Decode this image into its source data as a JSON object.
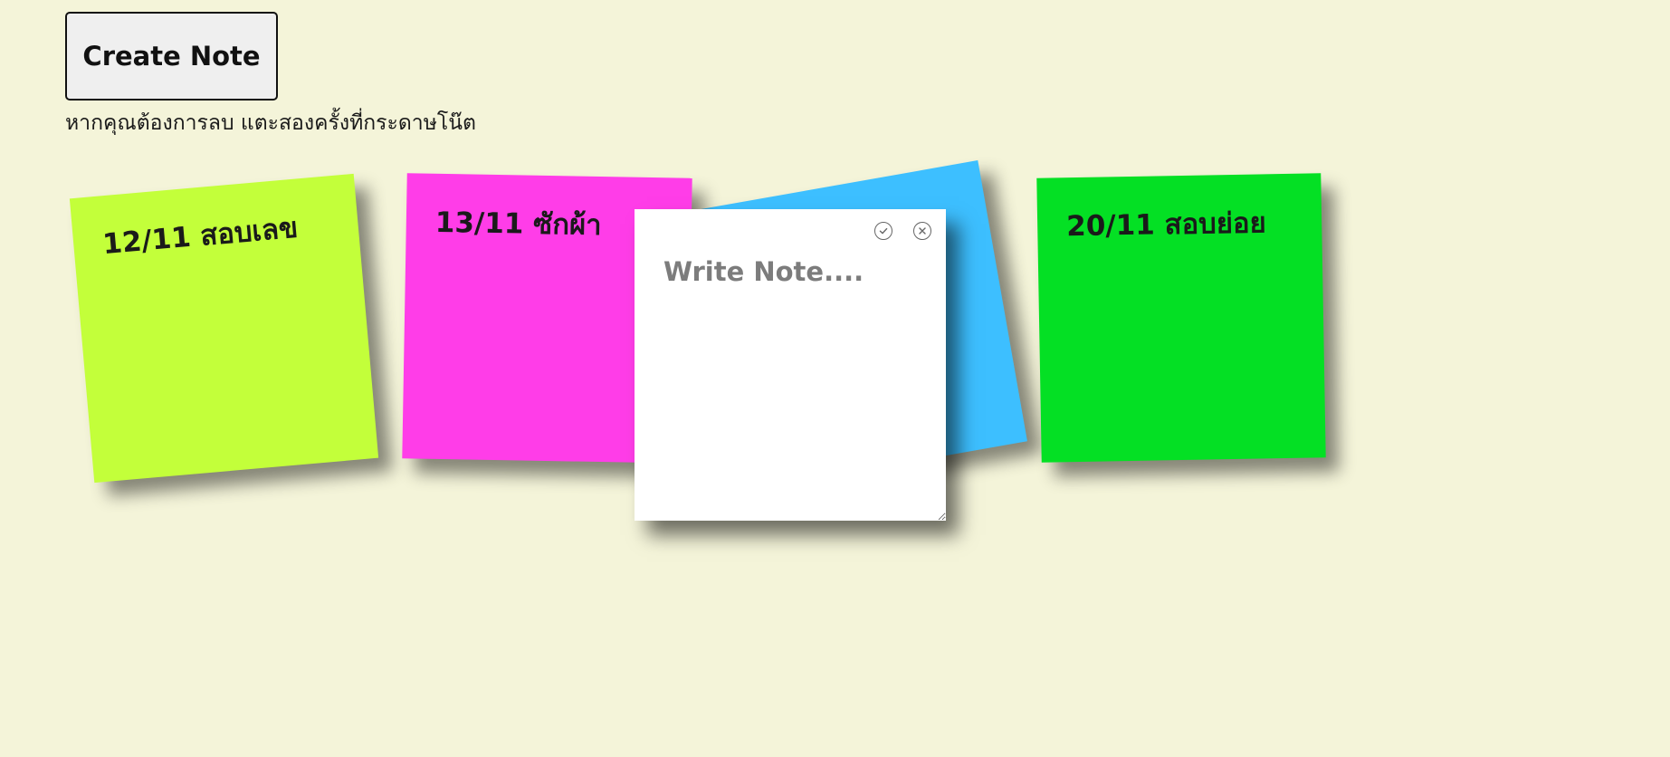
{
  "app": {
    "create_button_label": "Create Note",
    "hint": "หากคุณต้องการลบ แตะสองครั้งที่กระดาษโน๊ต"
  },
  "notes": [
    {
      "text": "12/11 สอบเลข",
      "color": "#c3ff3a"
    },
    {
      "text": "13/11 ซักผ้า",
      "color": "#ff3de8"
    },
    {
      "text": "",
      "color": "#3dbfff"
    },
    {
      "text": "20/11 สอบย่อย",
      "color": "#04e024"
    }
  ],
  "editor": {
    "placeholder": "Write Note....",
    "value": "",
    "icons": [
      "check-circle-icon",
      "close-circle-icon"
    ]
  }
}
